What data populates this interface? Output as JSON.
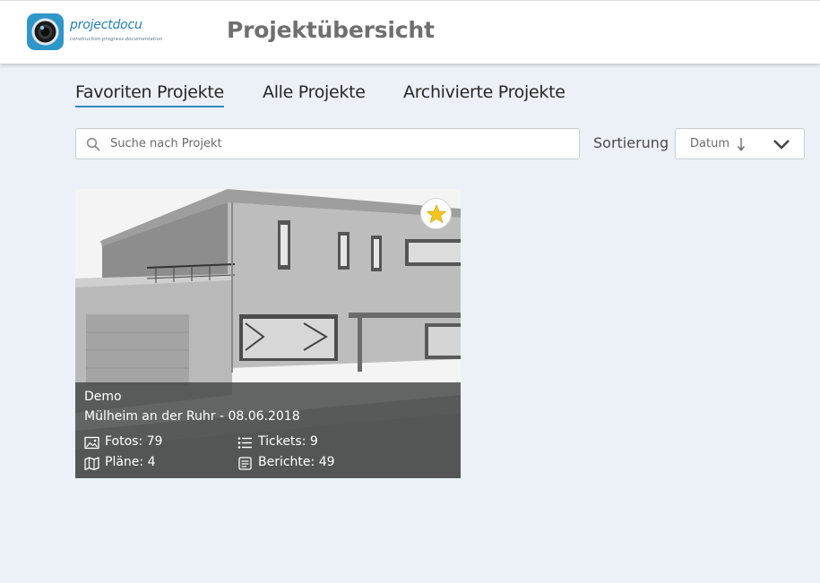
{
  "header": {
    "logo_name": "projectdocu",
    "logo_tagline": "construction progress documentation",
    "title": "Projektübersicht"
  },
  "tabs": [
    {
      "label": "Favoriten Projekte",
      "active": true
    },
    {
      "label": "Alle Projekte",
      "active": false
    },
    {
      "label": "Archivierte Projekte",
      "active": false
    }
  ],
  "search": {
    "placeholder": "Suche nach Projekt",
    "value": ""
  },
  "sort": {
    "label": "Sortierung",
    "selected": "Datum",
    "direction_icon": "arrow-down-icon"
  },
  "projects": [
    {
      "name": "Demo",
      "subtitle": "Mülheim an der Ruhr - 08.06.2018",
      "favorite": true,
      "stats": {
        "photos": "Fotos: 79",
        "tickets": "Tickets: 9",
        "plans": "Pläne: 4",
        "reports": "Berichte: 49"
      }
    }
  ],
  "colors": {
    "accent": "#2b8ac0",
    "background": "#ecf1f8",
    "favorite_star": "#f2c522",
    "overlay": "#464848"
  }
}
